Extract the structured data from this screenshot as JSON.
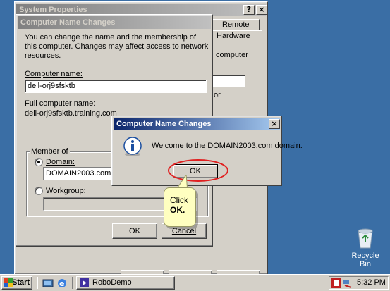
{
  "system_properties": {
    "title": "System Properties",
    "tabs": [
      "Remote",
      "Hardware"
    ],
    "partial_text": [
      "computer",
      "or"
    ]
  },
  "cnc_dialog": {
    "title": "Computer Name Changes",
    "description": "You can change the name and the membership of this computer. Changes may affect access to network resources.",
    "computer_name_label": "Computer name:",
    "computer_name_value": "dell-orj9sfsktb",
    "full_name_label": "Full computer name:",
    "full_name_value": "dell-orj9sfsktb.training.com",
    "member_of_label": "Member of",
    "domain_label": "Domain:",
    "domain_value": "DOMAIN2003.com",
    "workgroup_label": "Workgroup:",
    "ok_label": "OK",
    "cancel_label": "Cancel"
  },
  "welcome_dialog": {
    "title": "Computer Name Changes",
    "message": "Welcome to the DOMAIN2003.com domain.",
    "ok_label": "OK",
    "icon": "info-icon"
  },
  "callout": {
    "line1": "Click",
    "line2": "OK."
  },
  "desktop": {
    "recycle_bin_label": "Recycle Bin"
  },
  "taskbar": {
    "start_label": "Start",
    "task_label": "RoboDemo",
    "clock": "5:32 PM"
  },
  "colors": {
    "desktop": "#3a6ea5",
    "active_title": "#0a246a",
    "highlight_ring": "#e02020",
    "callout_bg": "#ffffc0"
  }
}
